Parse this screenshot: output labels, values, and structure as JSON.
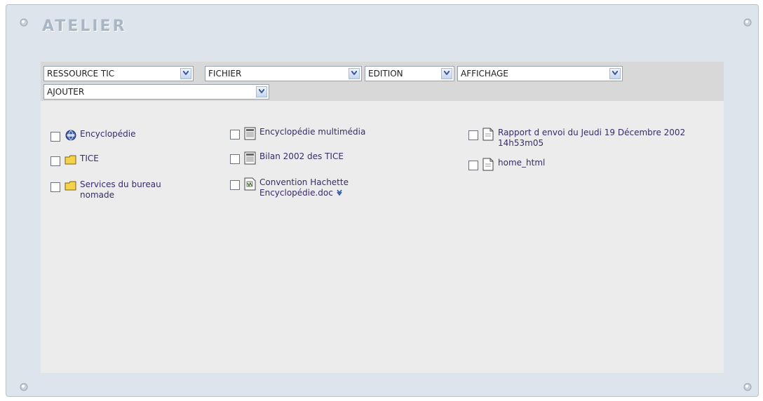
{
  "panel": {
    "title": "ATELIER"
  },
  "toolbar": {
    "selects": [
      {
        "label": "RESSOURCE TIC"
      },
      {
        "label": "FICHIER"
      },
      {
        "label": "EDITION"
      },
      {
        "label": "AFFICHAGE"
      },
      {
        "label": "AJOUTER"
      }
    ]
  },
  "items": {
    "col1": [
      {
        "label": "Encyclopédie",
        "icon": "globe-link-icon"
      },
      {
        "label": "TICE",
        "icon": "folder-icon"
      },
      {
        "label": "Services du bureau nomade",
        "icon": "folder-icon"
      }
    ],
    "col2": [
      {
        "label": "Encyclopédie multimédia",
        "icon": "html-document-icon"
      },
      {
        "label": "Bilan 2002 des TICE",
        "icon": "html-document-icon"
      },
      {
        "label": "Convention Hachette Encyclopédie.doc",
        "icon": "word-document-icon"
      }
    ],
    "col3": [
      {
        "label": "Rapport d envoi du Jeudi 19 Décembre 2002 14h53m05",
        "icon": "document-icon"
      },
      {
        "label": "home_html",
        "icon": "document-icon"
      }
    ]
  },
  "colors": {
    "frame": "#dde4ec",
    "content": "#ececec",
    "toolbar": "#d8d8d8",
    "link": "#3a2a6a",
    "title": "#a8b6c6"
  }
}
